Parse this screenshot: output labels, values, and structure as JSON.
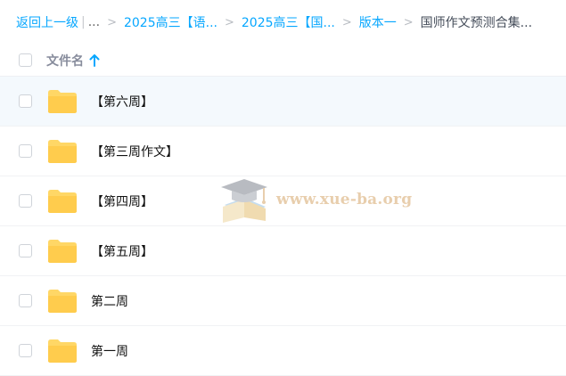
{
  "breadcrumb": {
    "back": "返回上一级",
    "ellipsis": "...",
    "crumbs": [
      "2025高三【语...",
      "2025高三【国...",
      "版本一"
    ],
    "current": "国师作文预测合集..."
  },
  "header": {
    "column_name": "文件名"
  },
  "files": [
    {
      "name": "【第六周】"
    },
    {
      "name": "【第三周作文】"
    },
    {
      "name": "【第四周】"
    },
    {
      "name": "【第五周】"
    },
    {
      "name": "第二周"
    },
    {
      "name": "第一周"
    }
  ],
  "watermark": {
    "text": "www.xue-ba.org"
  },
  "colors": {
    "accent": "#06a7ff",
    "folder": "#ffd766",
    "selected_row": "#f4f9fd"
  }
}
